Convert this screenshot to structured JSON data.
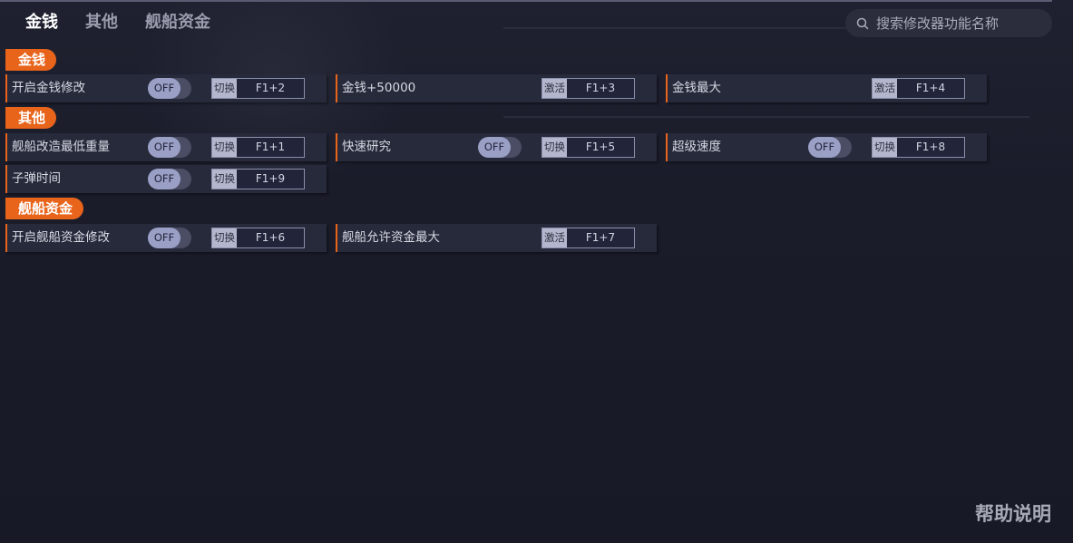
{
  "tabs": [
    {
      "label": "金钱",
      "active": true
    },
    {
      "label": "其他",
      "active": false
    },
    {
      "label": "舰船资金",
      "active": false
    }
  ],
  "search": {
    "placeholder": "搜索修改器功能名称",
    "icon": "search-icon"
  },
  "sections": [
    {
      "title": "金钱",
      "items": [
        {
          "label": "开启金钱修改",
          "toggle": "OFF",
          "hotkey_type": "切换",
          "hotkey": "F1+2"
        },
        {
          "label": "金钱+50000",
          "hotkey_type": "激活",
          "hotkey": "F1+3"
        },
        {
          "label": "金钱最大",
          "hotkey_type": "激活",
          "hotkey": "F1+4"
        }
      ]
    },
    {
      "title": "其他",
      "items": [
        {
          "label": "舰船改造最低重量",
          "toggle": "OFF",
          "hotkey_type": "切换",
          "hotkey": "F1+1"
        },
        {
          "label": "快速研究",
          "toggle": "OFF",
          "hotkey_type": "切换",
          "hotkey": "F1+5"
        },
        {
          "label": "超级速度",
          "toggle": "OFF",
          "hotkey_type": "切换",
          "hotkey": "F1+8"
        },
        {
          "label": "子弹时间",
          "toggle": "OFF",
          "hotkey_type": "切换",
          "hotkey": "F1+9"
        }
      ]
    },
    {
      "title": "舰船资金",
      "items": [
        {
          "label": "开启舰船资金修改",
          "toggle": "OFF",
          "hotkey_type": "切换",
          "hotkey": "F1+6"
        },
        {
          "label": "舰船允许资金最大",
          "hotkey_type": "激活",
          "hotkey": "F1+7"
        }
      ]
    }
  ],
  "help": "帮助说明",
  "colors": {
    "accent": "#e8641b",
    "background": "#181a28",
    "row": "#272a3b"
  }
}
